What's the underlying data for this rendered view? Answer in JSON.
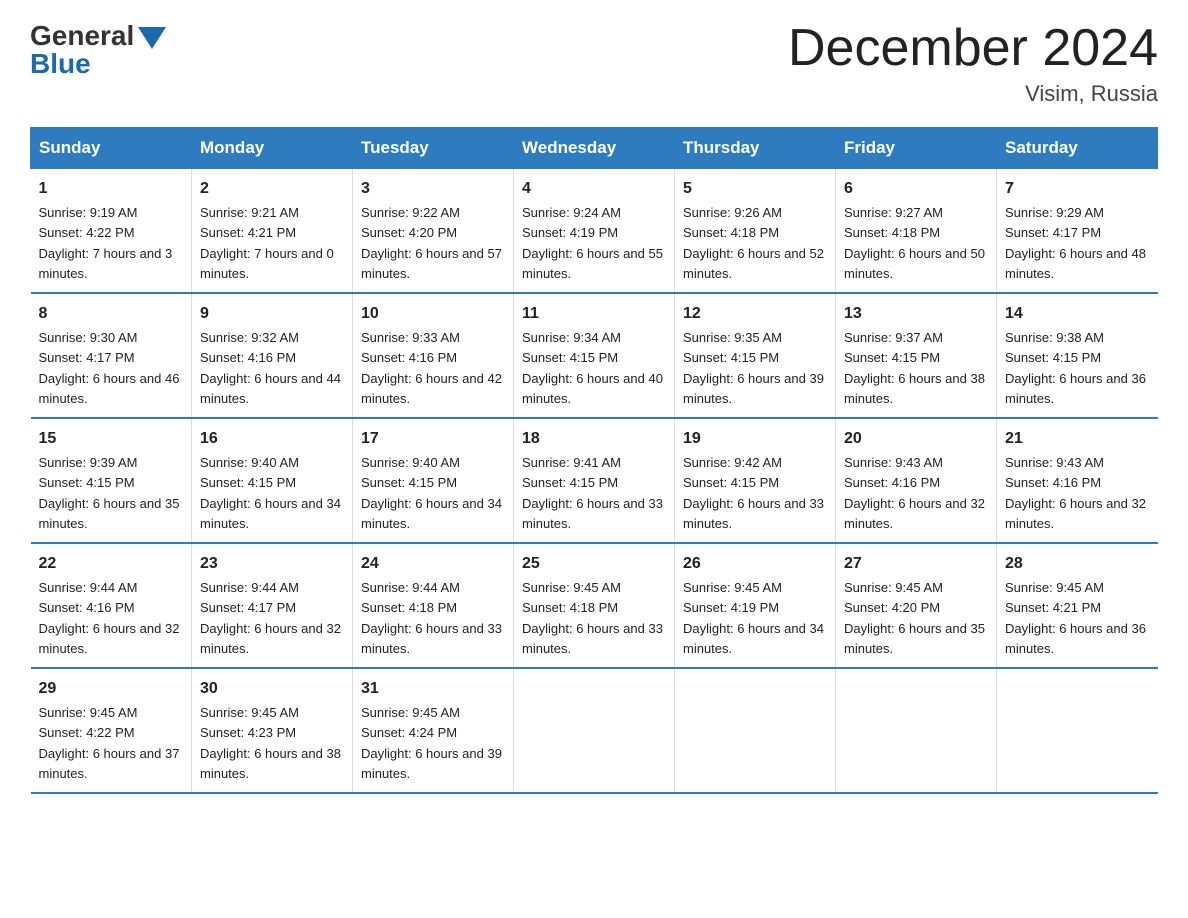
{
  "header": {
    "logo_general": "General",
    "logo_blue": "Blue",
    "month_title": "December 2024",
    "location": "Visim, Russia"
  },
  "days_of_week": [
    "Sunday",
    "Monday",
    "Tuesday",
    "Wednesday",
    "Thursday",
    "Friday",
    "Saturday"
  ],
  "weeks": [
    [
      {
        "day": "1",
        "sunrise": "9:19 AM",
        "sunset": "4:22 PM",
        "daylight": "7 hours and 3 minutes."
      },
      {
        "day": "2",
        "sunrise": "9:21 AM",
        "sunset": "4:21 PM",
        "daylight": "7 hours and 0 minutes."
      },
      {
        "day": "3",
        "sunrise": "9:22 AM",
        "sunset": "4:20 PM",
        "daylight": "6 hours and 57 minutes."
      },
      {
        "day": "4",
        "sunrise": "9:24 AM",
        "sunset": "4:19 PM",
        "daylight": "6 hours and 55 minutes."
      },
      {
        "day": "5",
        "sunrise": "9:26 AM",
        "sunset": "4:18 PM",
        "daylight": "6 hours and 52 minutes."
      },
      {
        "day": "6",
        "sunrise": "9:27 AM",
        "sunset": "4:18 PM",
        "daylight": "6 hours and 50 minutes."
      },
      {
        "day": "7",
        "sunrise": "9:29 AM",
        "sunset": "4:17 PM",
        "daylight": "6 hours and 48 minutes."
      }
    ],
    [
      {
        "day": "8",
        "sunrise": "9:30 AM",
        "sunset": "4:17 PM",
        "daylight": "6 hours and 46 minutes."
      },
      {
        "day": "9",
        "sunrise": "9:32 AM",
        "sunset": "4:16 PM",
        "daylight": "6 hours and 44 minutes."
      },
      {
        "day": "10",
        "sunrise": "9:33 AM",
        "sunset": "4:16 PM",
        "daylight": "6 hours and 42 minutes."
      },
      {
        "day": "11",
        "sunrise": "9:34 AM",
        "sunset": "4:15 PM",
        "daylight": "6 hours and 40 minutes."
      },
      {
        "day": "12",
        "sunrise": "9:35 AM",
        "sunset": "4:15 PM",
        "daylight": "6 hours and 39 minutes."
      },
      {
        "day": "13",
        "sunrise": "9:37 AM",
        "sunset": "4:15 PM",
        "daylight": "6 hours and 38 minutes."
      },
      {
        "day": "14",
        "sunrise": "9:38 AM",
        "sunset": "4:15 PM",
        "daylight": "6 hours and 36 minutes."
      }
    ],
    [
      {
        "day": "15",
        "sunrise": "9:39 AM",
        "sunset": "4:15 PM",
        "daylight": "6 hours and 35 minutes."
      },
      {
        "day": "16",
        "sunrise": "9:40 AM",
        "sunset": "4:15 PM",
        "daylight": "6 hours and 34 minutes."
      },
      {
        "day": "17",
        "sunrise": "9:40 AM",
        "sunset": "4:15 PM",
        "daylight": "6 hours and 34 minutes."
      },
      {
        "day": "18",
        "sunrise": "9:41 AM",
        "sunset": "4:15 PM",
        "daylight": "6 hours and 33 minutes."
      },
      {
        "day": "19",
        "sunrise": "9:42 AM",
        "sunset": "4:15 PM",
        "daylight": "6 hours and 33 minutes."
      },
      {
        "day": "20",
        "sunrise": "9:43 AM",
        "sunset": "4:16 PM",
        "daylight": "6 hours and 32 minutes."
      },
      {
        "day": "21",
        "sunrise": "9:43 AM",
        "sunset": "4:16 PM",
        "daylight": "6 hours and 32 minutes."
      }
    ],
    [
      {
        "day": "22",
        "sunrise": "9:44 AM",
        "sunset": "4:16 PM",
        "daylight": "6 hours and 32 minutes."
      },
      {
        "day": "23",
        "sunrise": "9:44 AM",
        "sunset": "4:17 PM",
        "daylight": "6 hours and 32 minutes."
      },
      {
        "day": "24",
        "sunrise": "9:44 AM",
        "sunset": "4:18 PM",
        "daylight": "6 hours and 33 minutes."
      },
      {
        "day": "25",
        "sunrise": "9:45 AM",
        "sunset": "4:18 PM",
        "daylight": "6 hours and 33 minutes."
      },
      {
        "day": "26",
        "sunrise": "9:45 AM",
        "sunset": "4:19 PM",
        "daylight": "6 hours and 34 minutes."
      },
      {
        "day": "27",
        "sunrise": "9:45 AM",
        "sunset": "4:20 PM",
        "daylight": "6 hours and 35 minutes."
      },
      {
        "day": "28",
        "sunrise": "9:45 AM",
        "sunset": "4:21 PM",
        "daylight": "6 hours and 36 minutes."
      }
    ],
    [
      {
        "day": "29",
        "sunrise": "9:45 AM",
        "sunset": "4:22 PM",
        "daylight": "6 hours and 37 minutes."
      },
      {
        "day": "30",
        "sunrise": "9:45 AM",
        "sunset": "4:23 PM",
        "daylight": "6 hours and 38 minutes."
      },
      {
        "day": "31",
        "sunrise": "9:45 AM",
        "sunset": "4:24 PM",
        "daylight": "6 hours and 39 minutes."
      },
      null,
      null,
      null,
      null
    ]
  ]
}
